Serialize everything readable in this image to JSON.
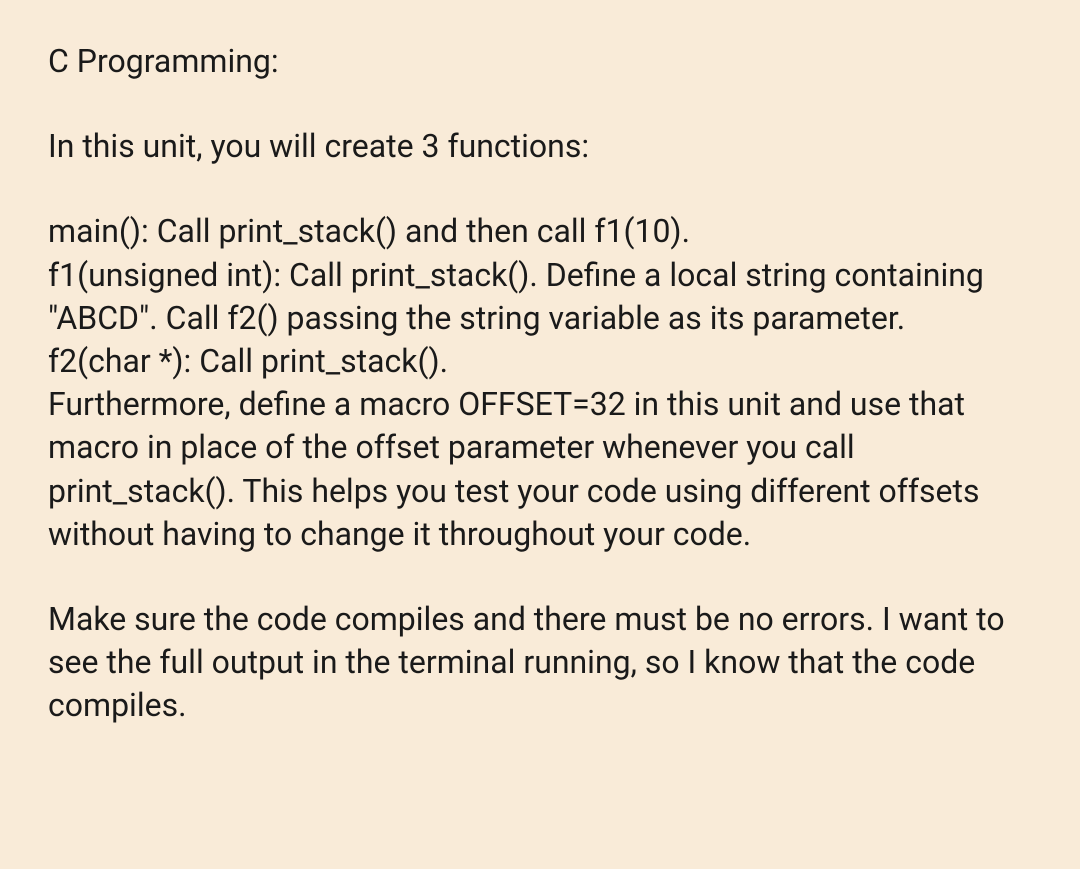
{
  "paragraphs": {
    "p1": "C Programming:",
    "p2": "In this unit, you will create 3 functions:",
    "p3": "main(): Call print_stack() and then call f1(10).\nf1(unsigned int): Call print_stack(). Define a local string containing \"ABCD\". Call f2() passing the string variable as its parameter.\nf2(char *): Call print_stack().\nFurthermore, define a macro OFFSET=32 in this unit and use that macro in place of the offset parameter whenever you call print_stack(). This helps you test your code using different offsets without having to change it throughout your code.",
    "p4": "Make sure the code compiles and there must be no errors. I want to see the full output in the terminal running, so I know that the code compiles."
  }
}
